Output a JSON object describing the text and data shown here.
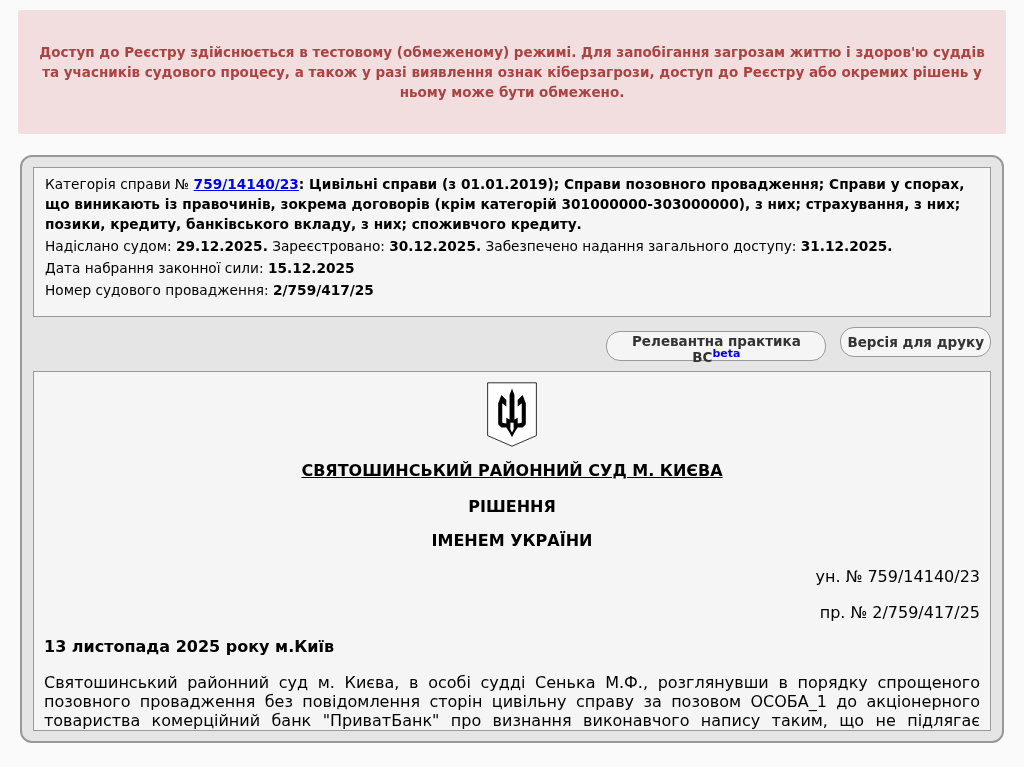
{
  "notice": "Доступ до Реєстру здійснюється в тестовому (обмеженому) режимі. Для запобігання загрозам життю і здоров'ю суддів та учасників судового процесу, а також у разі виявлення ознак кіберзагрози, доступ до Реєстру або окремих рішень у ньому може бути обмежено.",
  "case_info": {
    "category_label": "Категорія справи №",
    "case_link": "759/14140/23",
    "category_text": ": Цивільні справи (з 01.01.2019); Справи позовного провадження; Справи у спорах, що виникають із правочинів, зокрема договорів (крім категорій 301000000-303000000), з них; страхування, з них; позики, кредиту, банківського вкладу, з них; споживчого кредиту.",
    "lines": [
      [
        {
          "label": "Надіслано судом:",
          "value": "29.12.2025."
        },
        {
          "label": "Зареєстровано:",
          "value": "30.12.2025."
        },
        {
          "label": "Забезпечено надання загального доступу:",
          "value": "31.12.2025."
        }
      ],
      [
        {
          "label": "Дата набрання законної сили:",
          "value": "15.12.2025"
        }
      ],
      [
        {
          "label": "Номер судового провадження:",
          "value": "2/759/417/25"
        }
      ]
    ]
  },
  "buttons": [
    {
      "kind": "beta",
      "label": "Релевантна практика ВС",
      "sup": "beta"
    },
    {
      "kind": "plain",
      "label": "Версія для друку"
    }
  ],
  "document": {
    "court": "СВЯТОШИНСЬКИЙ РАЙОННИЙ СУД М. КИЄВА",
    "title": "РІШЕННЯ",
    "subtitle": "ІМЕНЕМ УКРАЇНИ",
    "numbers": [
      "ун. № 759/14140/23",
      "пр. № 2/759/417/25"
    ],
    "date_line": "13 листопада 2025 року м.Київ",
    "paragraph": "Святошинський районний суд м. Києва, в особі судді Сенька М.Ф., розглянувши в порядку спрощеного позовного провадження без повідомлення сторін цивільну справу за позовом ОСОБА_1 до акціонерного товариства комерційний банк \"ПриватБанк\" про визнання виконавчого напису таким, що не підлягає"
  }
}
